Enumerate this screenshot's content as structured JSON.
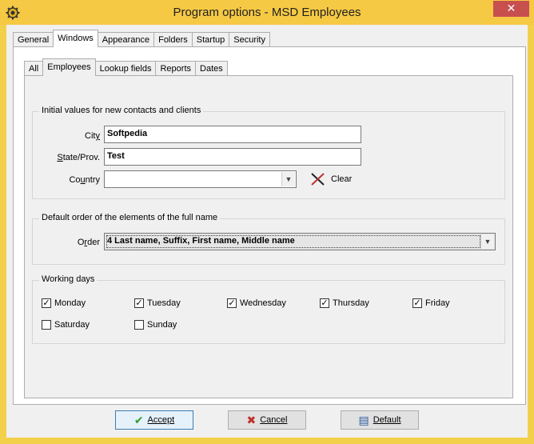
{
  "window": {
    "title": "Program options - MSD Employees",
    "close_glyph": "✕"
  },
  "outer_tabs": [
    {
      "label": "General"
    },
    {
      "label": "Windows",
      "active": true
    },
    {
      "label": "Appearance"
    },
    {
      "label": "Folders"
    },
    {
      "label": "Startup"
    },
    {
      "label": "Security"
    }
  ],
  "inner_tabs": [
    {
      "label": "All"
    },
    {
      "label": "Employees",
      "active": true
    },
    {
      "label": "Lookup fields"
    },
    {
      "label": "Reports"
    },
    {
      "label": "Dates"
    }
  ],
  "initial_values": {
    "group_label": "Initial values for new contacts and clients",
    "city_label_pre": "Cit",
    "city_label_u": "y",
    "city_value": "Softpedia",
    "state_label_pre": "",
    "state_label_u": "S",
    "state_label_post": "tate/Prov.",
    "state_value": "Test",
    "country_label_pre": "Co",
    "country_label_u": "u",
    "country_label_post": "ntry",
    "country_value": "",
    "clear_label": "Clear"
  },
  "full_name": {
    "group_label": "Default order of the elements of the full name",
    "order_label_pre": "O",
    "order_label_u": "r",
    "order_label_post": "der",
    "order_value": "4 Last name, Suffix, First name, Middle name"
  },
  "working_days": {
    "group_label": "Working days",
    "days": [
      {
        "label": "Monday",
        "checked": true
      },
      {
        "label": "Tuesday",
        "checked": true
      },
      {
        "label": "Wednesday",
        "checked": true
      },
      {
        "label": "Thursday",
        "checked": true
      },
      {
        "label": "Friday",
        "checked": true
      },
      {
        "label": "Saturday",
        "checked": false
      },
      {
        "label": "Sunday",
        "checked": false
      }
    ]
  },
  "buttons": {
    "accept": "Accept",
    "cancel": "Cancel",
    "default": "Default"
  },
  "colors": {
    "titlebar": "#f6c944",
    "close": "#c7504f",
    "accept_icon": "#2e9e2e",
    "cancel_icon": "#c0302a"
  }
}
